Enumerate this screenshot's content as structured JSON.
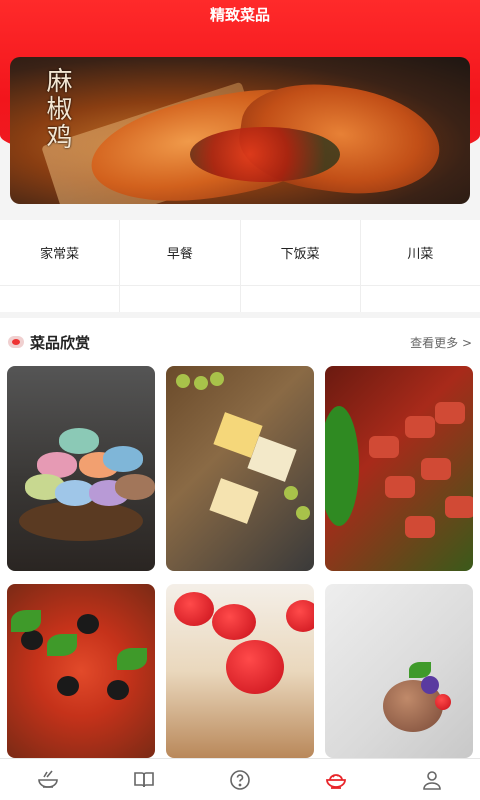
{
  "header": {
    "title": "精致菜品"
  },
  "banner": {
    "calligraphy": "麻椒鸡"
  },
  "categories": [
    {
      "label": "家常菜"
    },
    {
      "label": "早餐"
    },
    {
      "label": "下饭菜"
    },
    {
      "label": "川菜"
    }
  ],
  "section": {
    "title": "菜品欣赏",
    "more": "查看更多 >"
  },
  "cards": [
    {
      "name": "macarons"
    },
    {
      "name": "cheese-platter"
    },
    {
      "name": "skewers"
    },
    {
      "name": "pizza"
    },
    {
      "name": "strawberry-cake"
    },
    {
      "name": "ice-cream"
    }
  ],
  "tabbar": {
    "active_index": 3,
    "active_color": "#e8252a",
    "icons": [
      "bowl-icon",
      "book-icon",
      "question-icon",
      "dish-icon",
      "user-icon"
    ]
  },
  "colors": {
    "brand": "#ef1c22",
    "background": "#f4f4f4"
  }
}
